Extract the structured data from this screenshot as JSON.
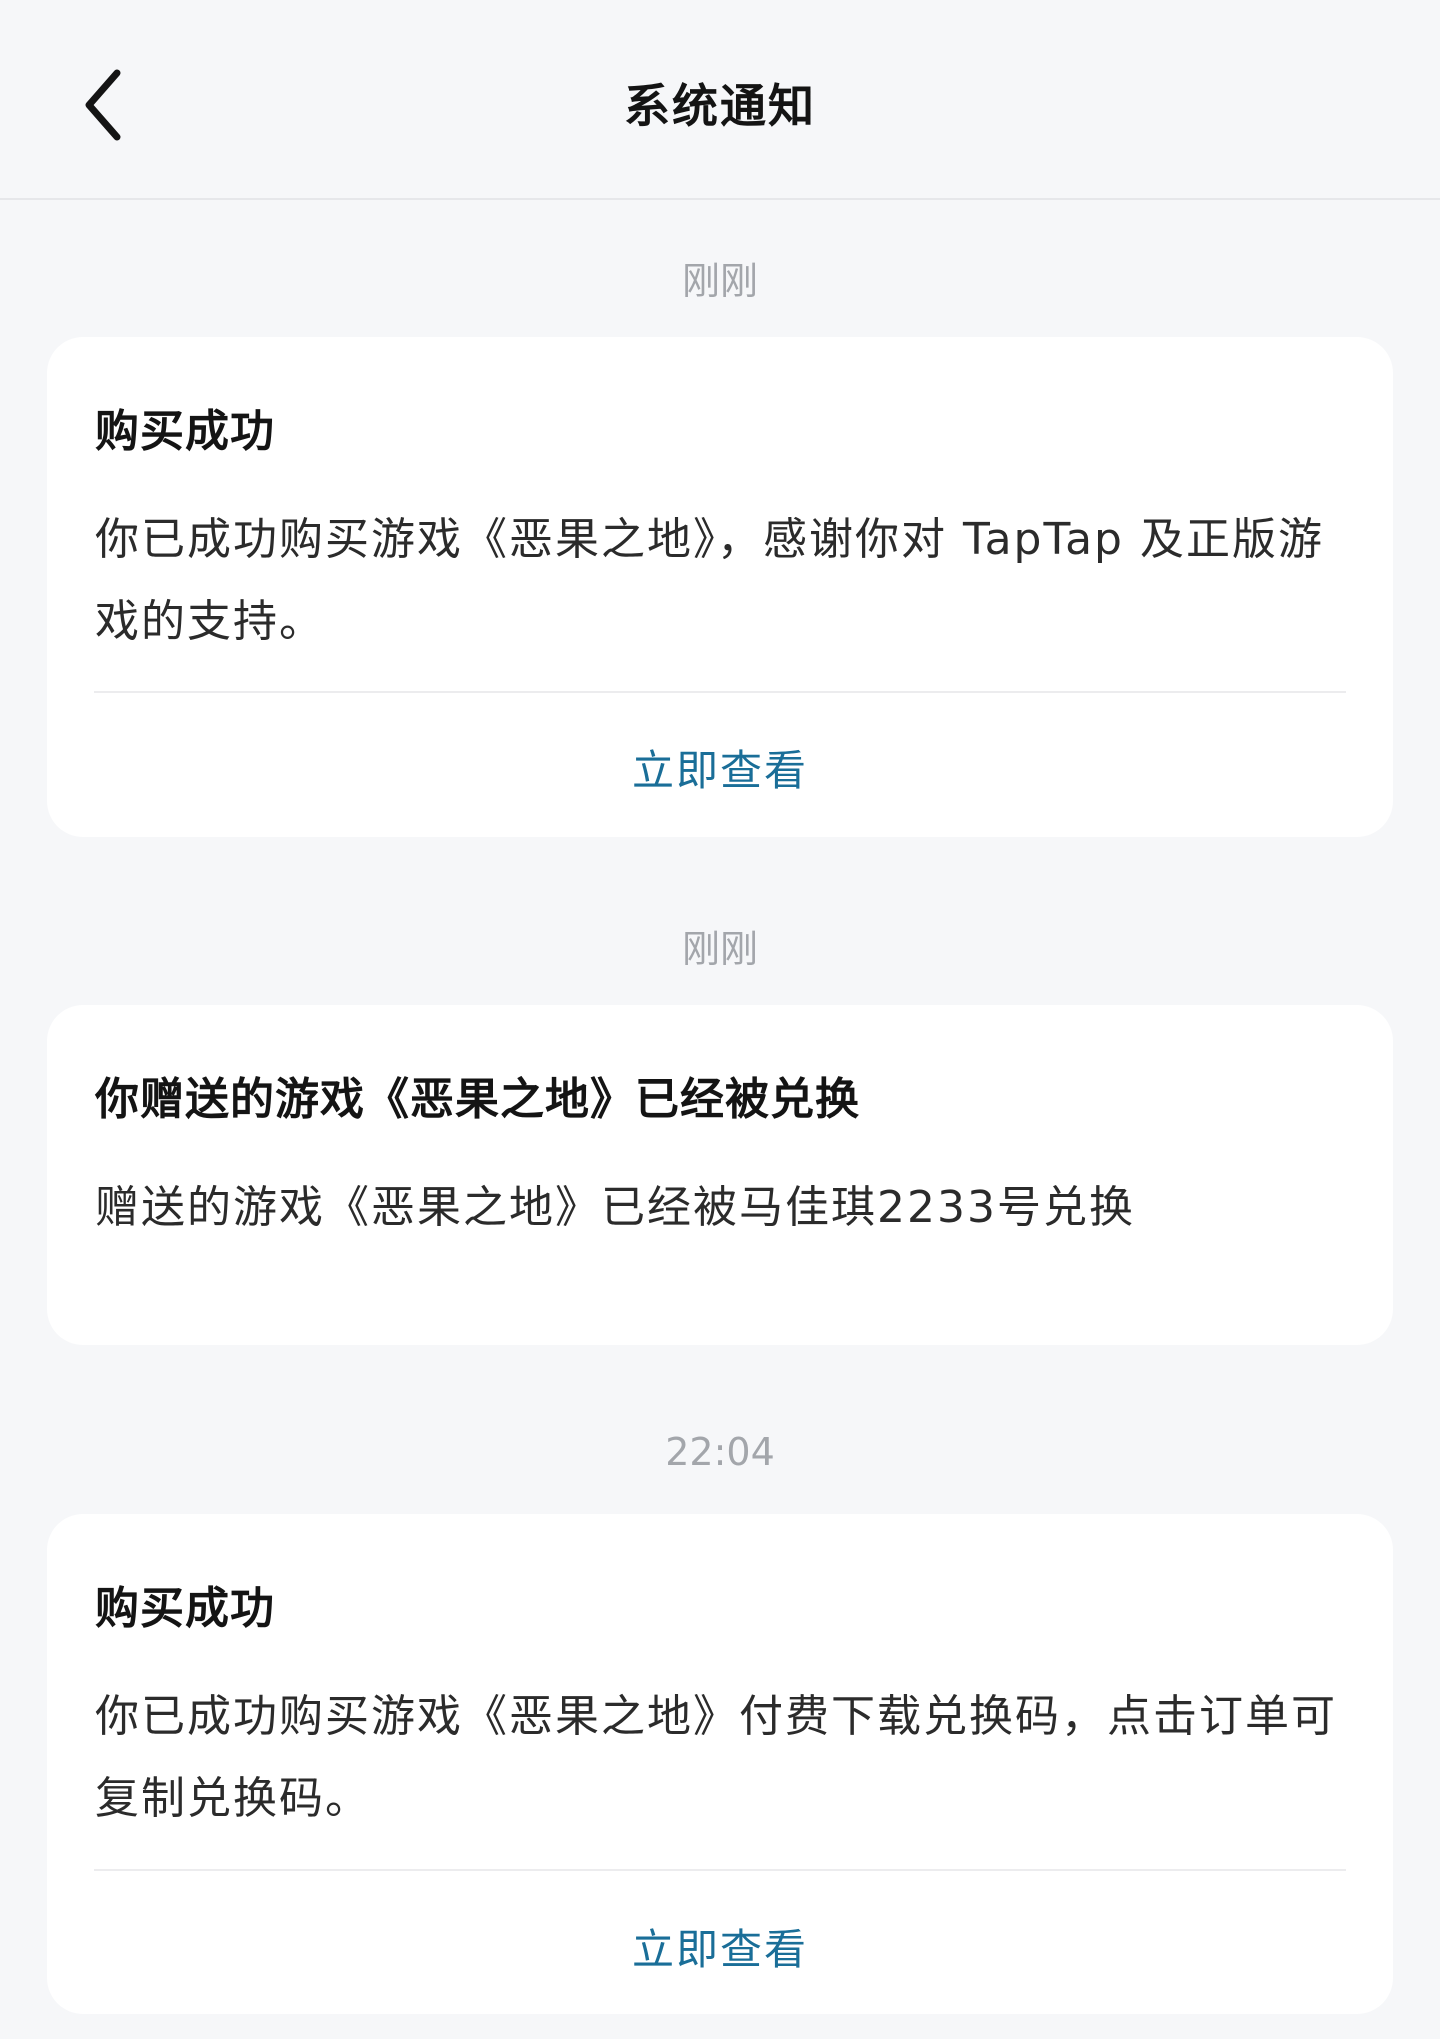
{
  "header": {
    "title": "系统通知",
    "back_icon": "chevron-left-icon"
  },
  "notifications": [
    {
      "time": "刚刚",
      "title": "购买成功",
      "body": "你已成功购买游戏《恶果之地》，感谢你对 TapTap 及正版游戏的支持。",
      "action": "立即查看"
    },
    {
      "time": "刚刚",
      "title": "你赠送的游戏《恶果之地》已经被兑换",
      "body": "赠送的游戏《恶果之地》已经被马佳琪2233号兑换"
    },
    {
      "time": "22:04",
      "title": "购买成功",
      "body": "你已成功购买游戏《恶果之地》付费下载兑换码，点击订单可复制兑换码。",
      "action": "立即查看"
    }
  ],
  "colors": {
    "background": "#f6f7f9",
    "card": "#ffffff",
    "action_link": "#1a6e98",
    "time_label": "#a3a6ab"
  }
}
